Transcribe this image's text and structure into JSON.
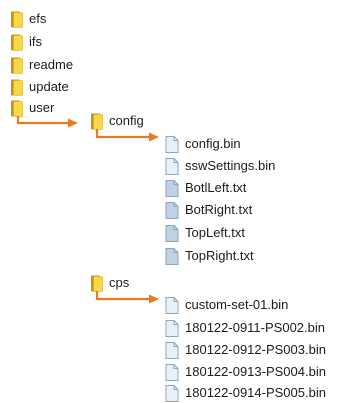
{
  "colors": {
    "arrow": "#e97a1f",
    "folder_light": "#f7d84a",
    "folder_dark": "#c89412",
    "file_plain": "#e9f1f8",
    "file_text": "#bed2e3",
    "file_border": "#8ea5ba"
  },
  "tree": {
    "root_folders": [
      "efs",
      "ifs",
      "readme",
      "update",
      "user"
    ],
    "config": {
      "name": "config",
      "files": [
        "config.bin",
        "sswSettings.bin",
        "BotlLeft.txt",
        "BotRight.txt",
        "TopLeft.txt",
        "TopRight.txt"
      ]
    },
    "cps": {
      "name": "cps",
      "files": [
        "custom-set-01.bin",
        "180122-0911-PS002.bin",
        "180122-0912-PS003.bin",
        "180122-0913-PS004.bin",
        "180122-0914-PS005.bin"
      ]
    }
  }
}
